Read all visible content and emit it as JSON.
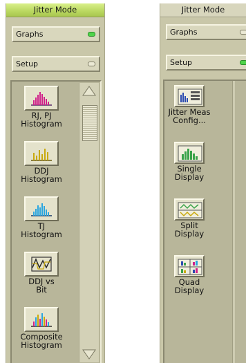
{
  "left_panel": {
    "title": "Jitter Mode",
    "graphs_button": "Graphs",
    "setup_button": "Setup",
    "items": [
      {
        "label": "RJ, PJ\nHistogram",
        "icon": "rj-pj-histogram-icon"
      },
      {
        "label": "DDJ\nHistogram",
        "icon": "ddj-histogram-icon"
      },
      {
        "label": "TJ\nHistogram",
        "icon": "tj-histogram-icon"
      },
      {
        "label": "DDJ vs\nBit",
        "icon": "ddj-vs-bit-icon"
      },
      {
        "label": "Composite\nHistogram",
        "icon": "composite-histogram-icon"
      }
    ]
  },
  "right_panel": {
    "title": "Jitter Mode",
    "graphs_button": "Graphs",
    "setup_button": "Setup",
    "items": [
      {
        "label": "Jitter Meas\nConfig...",
        "icon": "jitter-meas-config-icon"
      },
      {
        "label": "Single\nDisplay",
        "icon": "single-display-icon"
      },
      {
        "label": "Split\nDisplay",
        "icon": "split-display-icon"
      },
      {
        "label": "Quad\nDisplay",
        "icon": "quad-display-icon"
      }
    ]
  },
  "colors": {
    "title_active": "#b9d760",
    "panel_bg": "#c9c7a9",
    "led_on": "#4fd34a"
  }
}
